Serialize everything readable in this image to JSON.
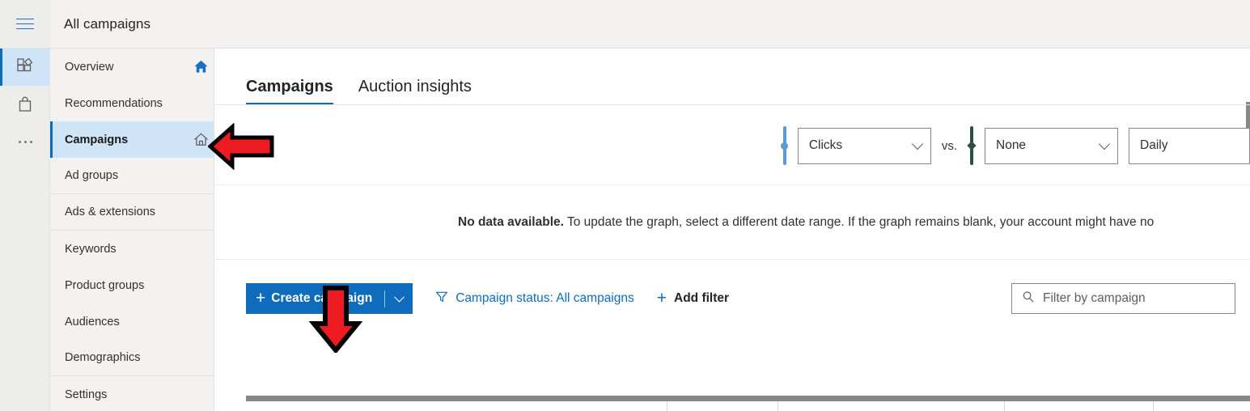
{
  "app": {
    "header_title": "All campaigns",
    "menu_icon": "hamburger-icon"
  },
  "rail": {
    "items": [
      {
        "icon": "dashboard-grid-icon",
        "name": "rail-item-dashboard",
        "active": true
      },
      {
        "icon": "shopping-bag-icon",
        "name": "rail-item-tools",
        "active": false
      },
      {
        "icon": "ellipsis-icon",
        "name": "rail-item-more",
        "active": false
      }
    ]
  },
  "sidebar": {
    "items": [
      {
        "label": "Overview",
        "home_icon": "home-filled-icon",
        "selected": false,
        "group_end": false
      },
      {
        "label": "Recommendations",
        "home_icon": null,
        "selected": false,
        "group_end": false
      },
      {
        "label": "Campaigns",
        "home_icon": "home-outline-icon",
        "selected": true,
        "group_end": false
      },
      {
        "label": "Ad groups",
        "home_icon": null,
        "selected": false,
        "group_end": true
      },
      {
        "label": "Ads & extensions",
        "home_icon": null,
        "selected": false,
        "group_end": true
      },
      {
        "label": "Keywords",
        "home_icon": null,
        "selected": false,
        "group_end": false
      },
      {
        "label": "Product groups",
        "home_icon": null,
        "selected": false,
        "group_end": false
      },
      {
        "label": "Audiences",
        "home_icon": null,
        "selected": false,
        "group_end": false
      },
      {
        "label": "Demographics",
        "home_icon": null,
        "selected": false,
        "group_end": true
      },
      {
        "label": "Settings",
        "home_icon": null,
        "selected": false,
        "group_end": false
      }
    ]
  },
  "main": {
    "tabs": [
      {
        "label": "Campaigns",
        "active": true
      },
      {
        "label": "Auction insights",
        "active": false
      }
    ],
    "chart_controls": {
      "metric_primary": {
        "value": "Clicks",
        "marker_color": "#5b9bd5"
      },
      "vs_label": "vs.",
      "metric_secondary": {
        "value": "None",
        "marker_color": "#2c4f43"
      },
      "granularity": {
        "value": "Daily"
      }
    },
    "no_data": {
      "headline": "No data available.",
      "body": " To update the graph, select a different date range. If the graph remains blank, your account might have no"
    },
    "toolbar": {
      "create_label": "Create campaign",
      "create_plus_icon": "plus-icon",
      "create_caret_icon": "chevron-down-icon",
      "status_filter_label": "Campaign status: All campaigns",
      "status_filter_icon": "funnel-icon",
      "add_filter_label": "Add filter",
      "add_filter_icon": "plus-icon",
      "search_placeholder": "Filter by campaign",
      "search_value": "",
      "search_icon": "search-icon"
    }
  },
  "annotations": [
    {
      "name": "red-arrow-left",
      "direction": "left",
      "color": "#ee1c22",
      "points_at": "sidebar-item-campaigns"
    },
    {
      "name": "red-arrow-down",
      "direction": "down",
      "color": "#ee1c22",
      "points_at": "create-campaign-button"
    }
  ],
  "colors": {
    "accent_blue": "#0f6cbd",
    "selection_blue": "#cfe4f7",
    "chrome_gray": "#f3f2f1",
    "rail_gray": "#ededeb",
    "annotation_red": "#ee1c22"
  },
  "chart_data": {
    "type": "line",
    "title": "",
    "series": [
      {
        "name": "Clicks",
        "values": [],
        "color": "#5b9bd5"
      },
      {
        "name": "None",
        "values": [],
        "color": "#2c4f43"
      }
    ],
    "x": [],
    "granularity": "Daily",
    "state": "empty",
    "empty_message": "No data available. To update the graph, select a different date range. If the graph remains blank, your account might have no",
    "grid": false,
    "legend": "none"
  }
}
